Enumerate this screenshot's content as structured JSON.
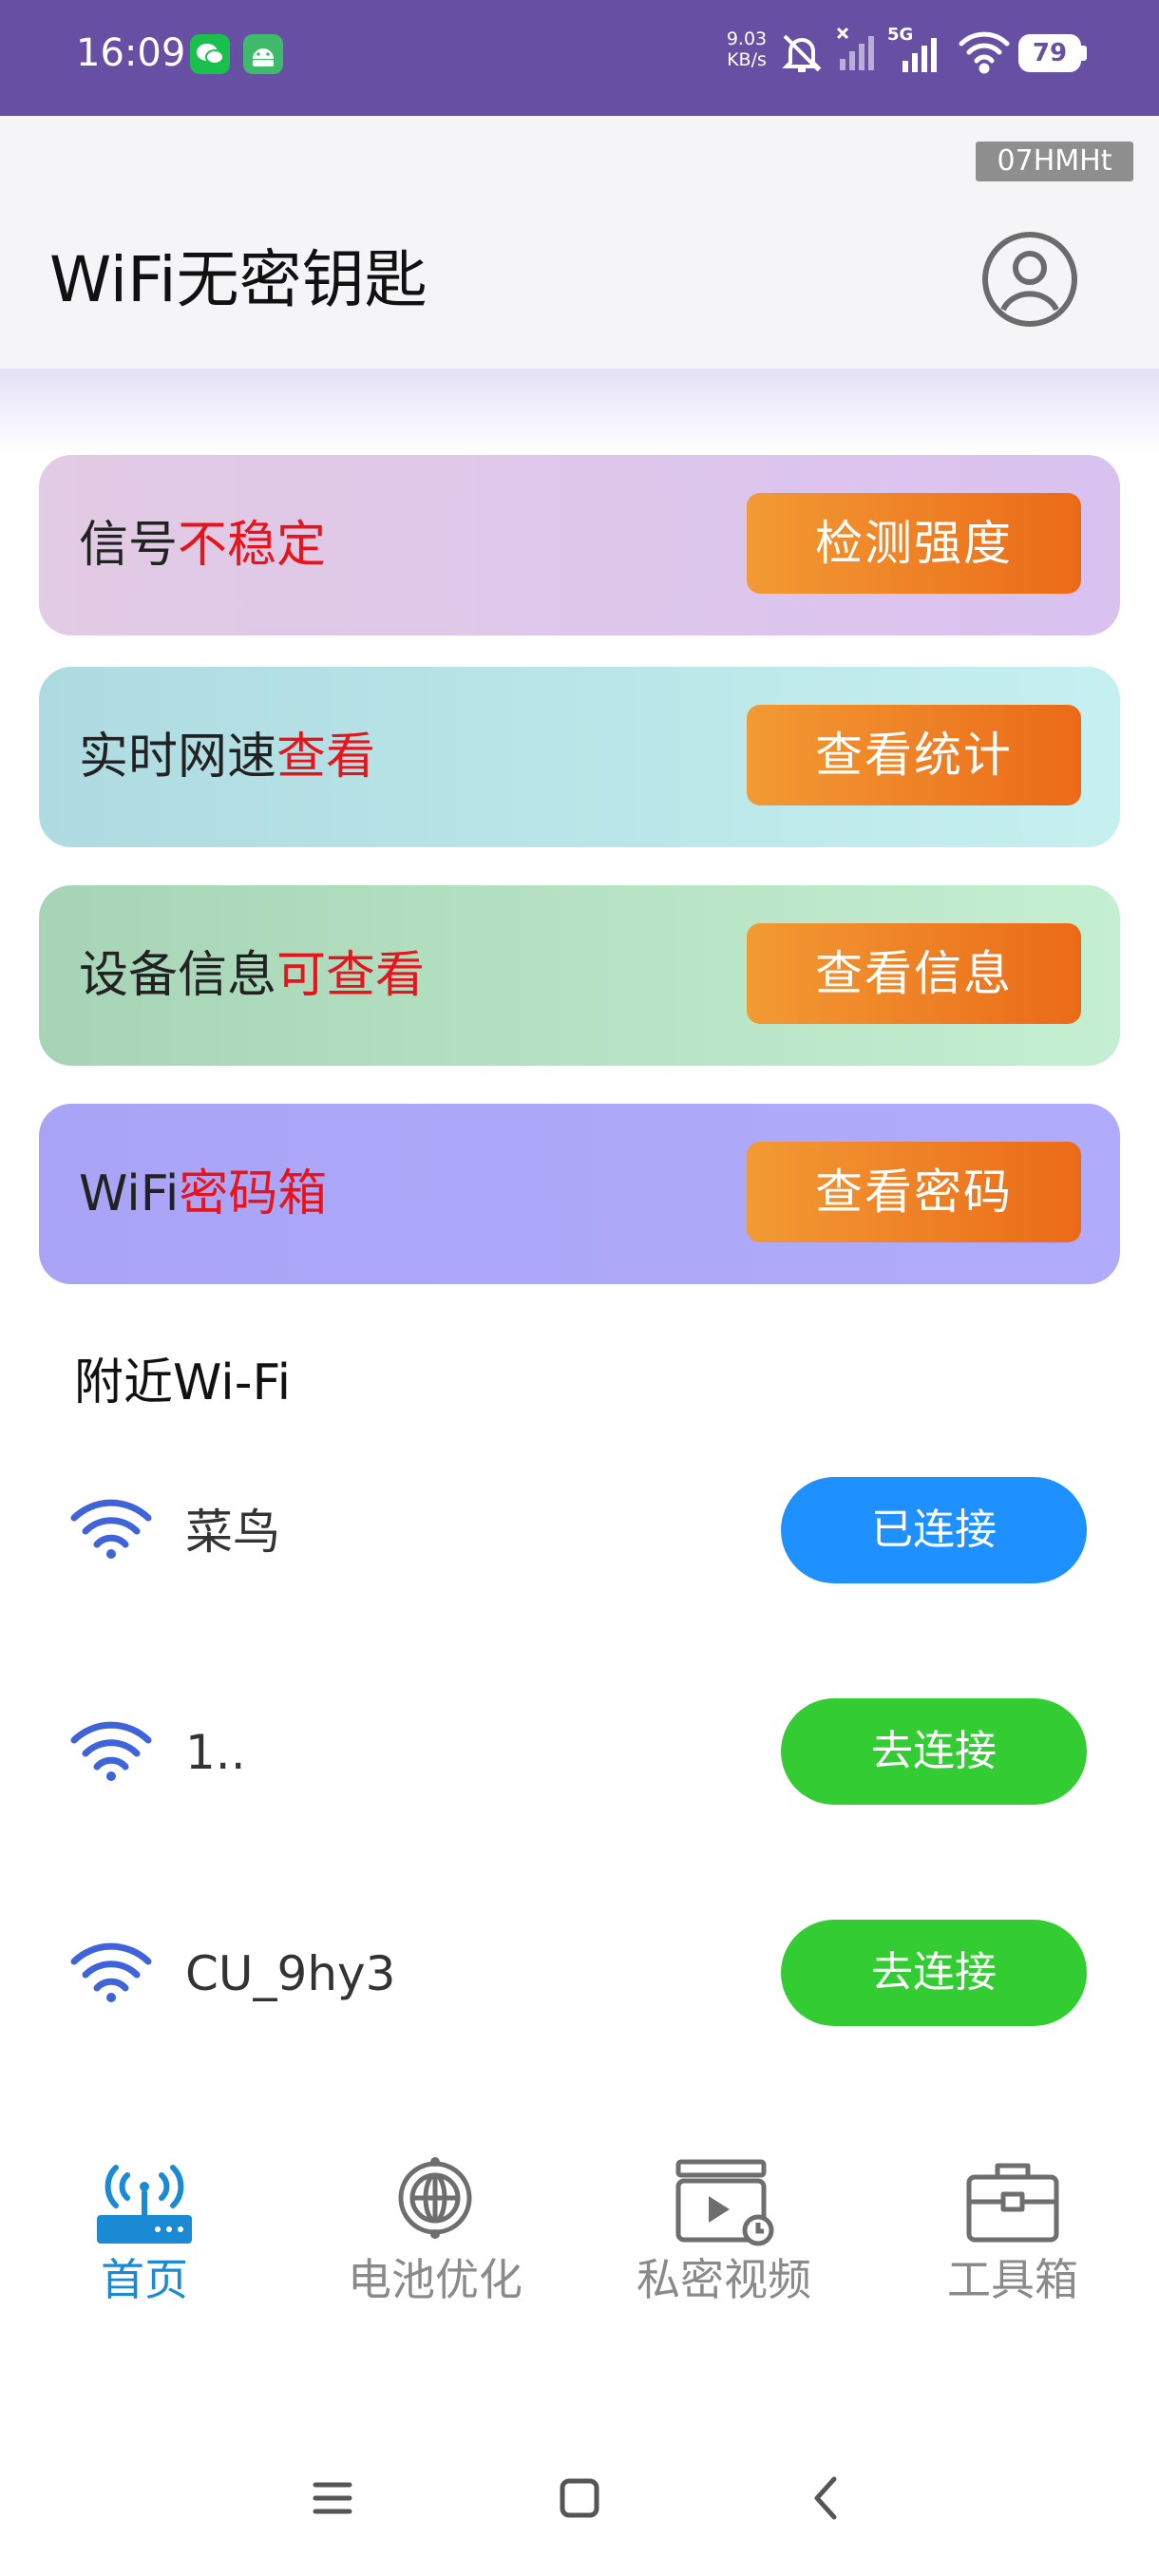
{
  "status_bar": {
    "time": "16:09",
    "net_speed_value": "9.03",
    "net_speed_unit": "KB/s",
    "network_type": "5G",
    "battery": "79"
  },
  "header": {
    "build_tag": "07HMHt",
    "title": "WiFi无密钥匙"
  },
  "feature_cards": [
    {
      "label_prefix": "信号",
      "label_highlight": "不稳定",
      "button": "检测强度"
    },
    {
      "label_prefix": "实时网速",
      "label_highlight": "查看",
      "button": "查看统计"
    },
    {
      "label_prefix": "设备信息",
      "label_highlight": "可查看",
      "button": "查看信息"
    },
    {
      "label_prefix": "WiFi",
      "label_highlight": "密码箱",
      "button": "查看密码"
    }
  ],
  "nearby": {
    "title": "附近Wi-Fi",
    "networks": [
      {
        "name": "菜鸟",
        "button": "已连接",
        "status": "connected"
      },
      {
        "name": "1..",
        "button": "去连接",
        "status": "available"
      },
      {
        "name": "CU_9hy3",
        "button": "去连接",
        "status": "available"
      }
    ]
  },
  "bottom_nav": {
    "items": [
      {
        "label": "首页",
        "icon": "router-icon",
        "active": true
      },
      {
        "label": "电池优化",
        "icon": "globe-icon",
        "active": false
      },
      {
        "label": "私密视频",
        "icon": "video-icon",
        "active": false
      },
      {
        "label": "工具箱",
        "icon": "toolbox-icon",
        "active": false
      }
    ]
  },
  "colors": {
    "status_bar": "#6750a4",
    "highlight_text": "#e8141c",
    "card_button": "#ef8228",
    "connected_button": "#1e90ff",
    "connect_button": "#33cc33",
    "nav_active": "#1a8ad4",
    "wifi_icon": "#3f63d8"
  }
}
